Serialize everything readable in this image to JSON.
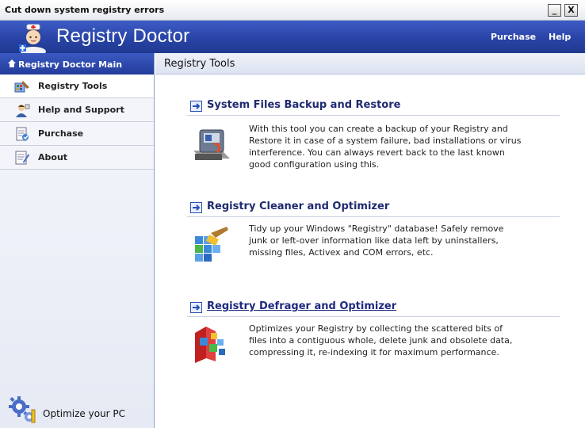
{
  "window": {
    "title": "Cut down system registry errors",
    "minimize_label": "_",
    "close_label": "X"
  },
  "header": {
    "app_title": "Registry Doctor",
    "links": [
      "Purchase",
      "Help"
    ]
  },
  "sidebar": {
    "heading": "Registry Doctor Main",
    "items": [
      {
        "label": "Registry Tools",
        "icon": "registry-tools-icon",
        "active": true
      },
      {
        "label": "Help and Support",
        "icon": "help-support-icon",
        "active": false
      },
      {
        "label": "Purchase",
        "icon": "purchase-icon",
        "active": false
      },
      {
        "label": "About",
        "icon": "about-icon",
        "active": false
      }
    ],
    "footer_label": "Optimize your PC"
  },
  "main": {
    "heading": "Registry Tools",
    "tools": [
      {
        "title": "System Files Backup and Restore",
        "description": "With this tool you can create a backup of your Registry and Restore it in case of a system failure, bad installations or virus interference. You can always revert back to the last known good configuration using this.",
        "icon": "backup-restore-icon"
      },
      {
        "title": "Registry Cleaner and Optimizer",
        "description": "Tidy up your Windows \"Registry\" database! Safely remove junk or left-over information like data left by uninstallers, missing files, Activex and COM errors, etc.",
        "icon": "registry-cleaner-icon"
      },
      {
        "title": "Registry Defrager and Optimizer",
        "description": "Optimizes your Registry by collecting the scattered bits of files into a contiguous whole, delete junk and obsolete data, compressing it, re-indexing it for maximum performance.",
        "icon": "defrager-icon"
      }
    ]
  },
  "colors": {
    "banner": "#2944a6",
    "link_title": "#1f2a70",
    "arrow": "#2b4fb5"
  }
}
